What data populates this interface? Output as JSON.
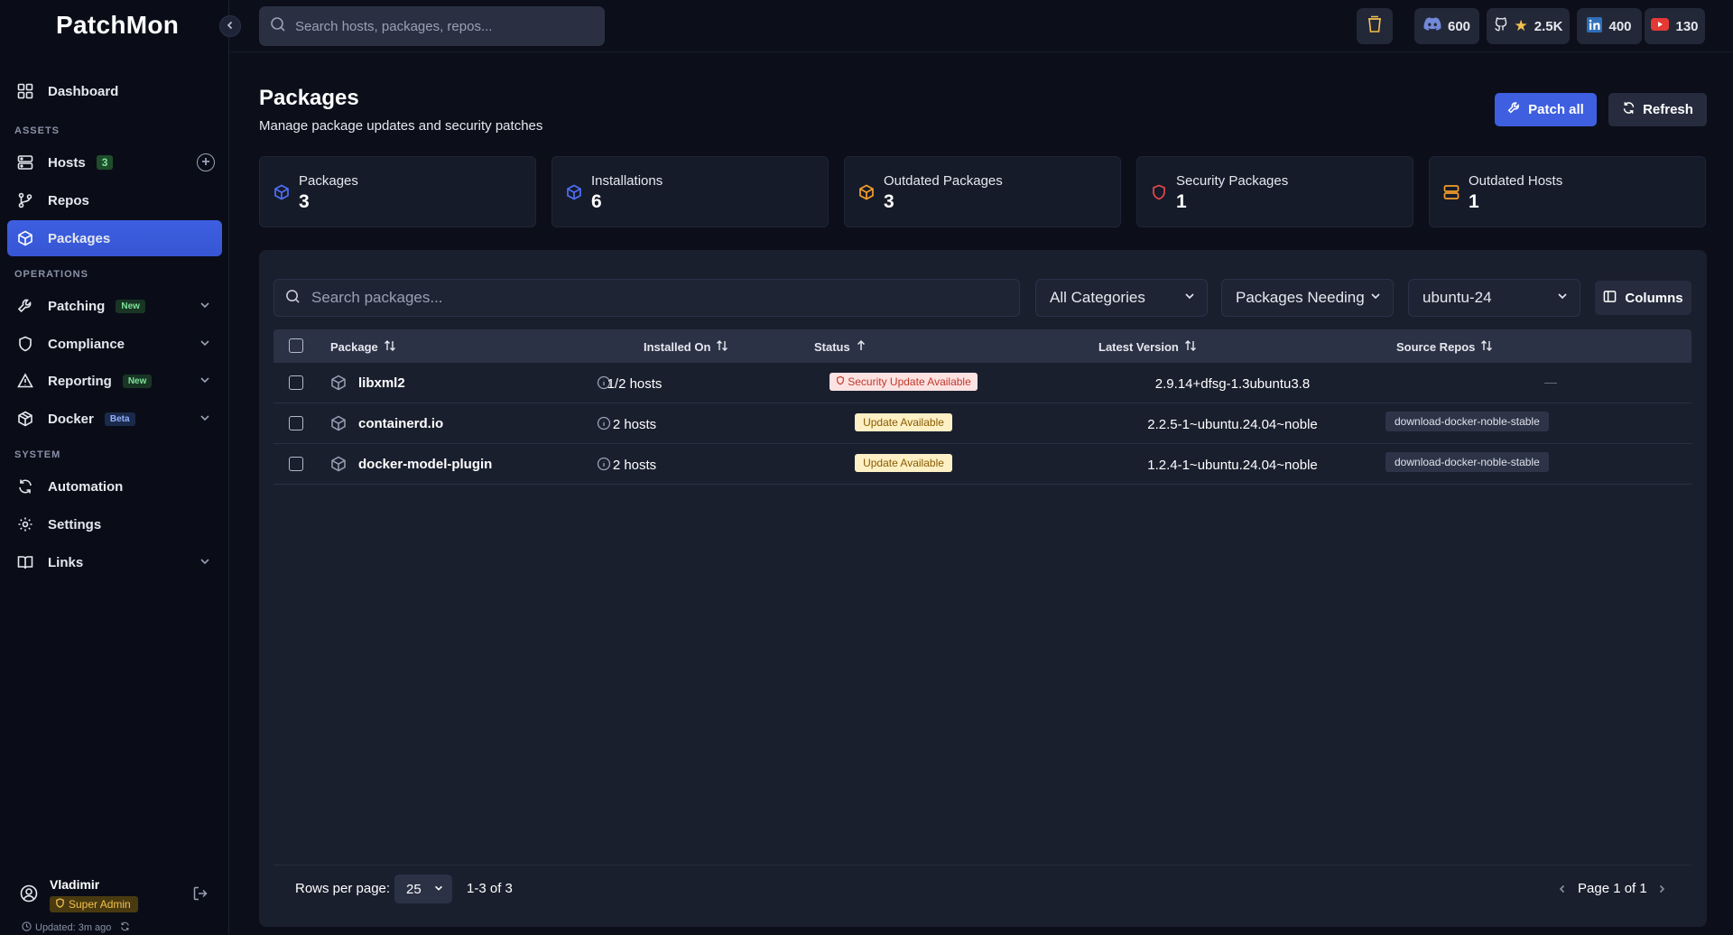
{
  "app": {
    "logo": "PatchMon",
    "global_search_placeholder": "Search hosts, packages, repos..."
  },
  "topbar": {
    "stats": [
      {
        "icon": "discord-icon",
        "value": "600"
      },
      {
        "icon": "github-star-icon",
        "value": "2.5K"
      },
      {
        "icon": "linkedin-icon",
        "value": "400"
      },
      {
        "icon": "youtube-icon",
        "value": "130"
      }
    ]
  },
  "sidebar": {
    "dashboard": "Dashboard",
    "section_assets": "ASSETS",
    "hosts": "Hosts",
    "hosts_count": "3",
    "repos": "Repos",
    "packages": "Packages",
    "section_operations": "OPERATIONS",
    "patching": "Patching",
    "patching_badge": "New",
    "compliance": "Compliance",
    "reporting": "Reporting",
    "reporting_badge": "New",
    "docker": "Docker",
    "docker_badge": "Beta",
    "section_system": "SYSTEM",
    "automation": "Automation",
    "settings": "Settings",
    "links": "Links",
    "user_name": "Vladimir",
    "user_role": "Super Admin",
    "updated": "Updated: 3m ago"
  },
  "page": {
    "title": "Packages",
    "subtitle": "Manage package updates and security patches",
    "patch_all": "Patch all",
    "refresh": "Refresh"
  },
  "stats": [
    {
      "label": "Packages",
      "value": "3",
      "color": "#4f6ef7"
    },
    {
      "label": "Installations",
      "value": "6",
      "color": "#4f6ef7"
    },
    {
      "label": "Outdated Packages",
      "value": "3",
      "color": "#f59f2a"
    },
    {
      "label": "Security Packages",
      "value": "1",
      "color": "#e5484d"
    },
    {
      "label": "Outdated Hosts",
      "value": "1",
      "color": "#f59f2a"
    }
  ],
  "filters": {
    "search_placeholder": "Search packages...",
    "category": "All Categories",
    "status": "Packages Needing",
    "os": "ubuntu-24",
    "columns": "Columns"
  },
  "table": {
    "headers": {
      "package": "Package",
      "installed_on": "Installed On",
      "status": "Status",
      "latest_version": "Latest Version",
      "source_repos": "Source Repos"
    },
    "rows": [
      {
        "name": "libxml2",
        "hosts": "1/2 hosts",
        "status": "Security Update Available",
        "status_type": "security",
        "latest": "2.9.14+dfsg-1.3ubuntu3.8",
        "repo": "—"
      },
      {
        "name": "containerd.io",
        "hosts": "2 hosts",
        "status": "Update Available",
        "status_type": "update",
        "latest": "2.2.5-1~ubuntu.24.04~noble",
        "repo": "download-docker-noble-stable"
      },
      {
        "name": "docker-model-plugin",
        "hosts": "2 hosts",
        "status": "Update Available",
        "status_type": "update",
        "latest": "1.2.4-1~ubuntu.24.04~noble",
        "repo": "download-docker-noble-stable"
      }
    ]
  },
  "pagination": {
    "rows_label": "Rows per page:",
    "rows_value": "25",
    "range": "1-3 of 3",
    "page": "Page 1 of 1"
  }
}
